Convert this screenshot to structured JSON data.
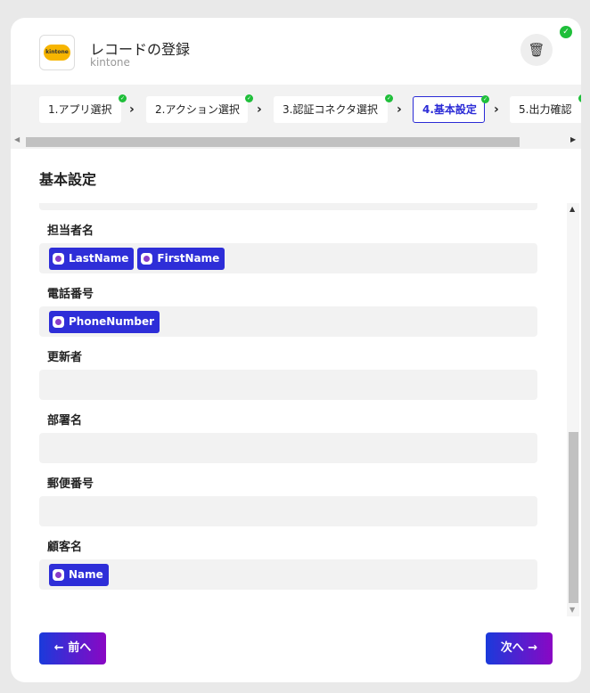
{
  "header": {
    "title": "レコードの登録",
    "subtitle": "kintone",
    "logo_text": "kintone"
  },
  "steps": [
    {
      "label": "1.アプリ選択"
    },
    {
      "label": "2.アクション選択"
    },
    {
      "label": "3.認証コネクタ選択"
    },
    {
      "label": "4.基本設定"
    },
    {
      "label": "5.出力確認"
    }
  ],
  "section_title": "基本設定",
  "fields": [
    {
      "label": "担当者名",
      "chips": [
        "LastName",
        "FirstName"
      ]
    },
    {
      "label": "電話番号",
      "chips": [
        "PhoneNumber"
      ]
    },
    {
      "label": "更新者",
      "chips": []
    },
    {
      "label": "部署名",
      "chips": []
    },
    {
      "label": "郵便番号",
      "chips": []
    },
    {
      "label": "顧客名",
      "chips": [
        "Name"
      ]
    }
  ],
  "buttons": {
    "prev": "← 前へ",
    "next": "次へ →"
  }
}
